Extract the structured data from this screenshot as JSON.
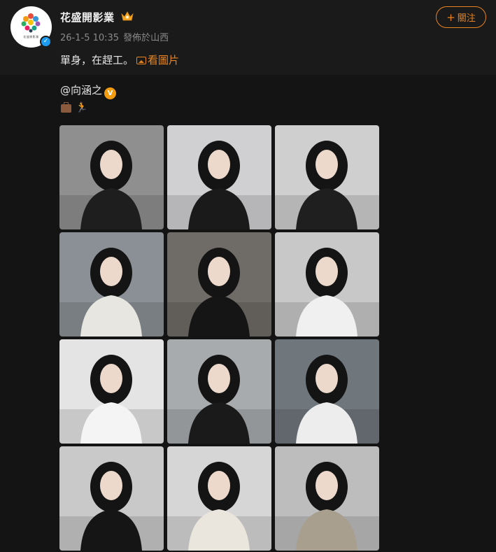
{
  "post": {
    "username": "花盛開影業",
    "timestamp": "26-1-5 10:35",
    "location": "發佈於山西",
    "follow_label": "關注",
    "text": "單身，在趕工。",
    "view_image_label": "看圖片",
    "avatar_text": "花盛開影業"
  },
  "repost": {
    "mention": "@向涵之",
    "emoji_icons": [
      "briefcase-icon",
      "runner-icon"
    ]
  },
  "colors": {
    "accent": "#e8831f",
    "verified": "#1d9bf0",
    "vip_badge": "#f39c12"
  },
  "photos": [
    {
      "id": "photo-1",
      "bg": "#8f8f8f",
      "fg": "#1e1e1e"
    },
    {
      "id": "photo-2",
      "bg": "#d0d0d2",
      "fg": "#1a1a1a"
    },
    {
      "id": "photo-3",
      "bg": "#cfcfcf",
      "fg": "#1f1f1f"
    },
    {
      "id": "photo-4",
      "bg": "#8a9096",
      "fg": "#e8e6e0"
    },
    {
      "id": "photo-5",
      "bg": "#6f6b66",
      "fg": "#151515"
    },
    {
      "id": "photo-6",
      "bg": "#c8c8c8",
      "fg": "#f0f0f0"
    },
    {
      "id": "photo-7",
      "bg": "#e4e4e4",
      "fg": "#f4f4f4"
    },
    {
      "id": "photo-8",
      "bg": "#a7abad",
      "fg": "#1a1a1a"
    },
    {
      "id": "photo-9",
      "bg": "#6f767c",
      "fg": "#ededed"
    },
    {
      "id": "photo-10",
      "bg": "#c9c9c9",
      "fg": "#151515"
    },
    {
      "id": "photo-11",
      "bg": "#d6d6d6",
      "fg": "#eae6de"
    },
    {
      "id": "photo-12",
      "bg": "#bdbdbd",
      "fg": "#a89f8e"
    }
  ]
}
